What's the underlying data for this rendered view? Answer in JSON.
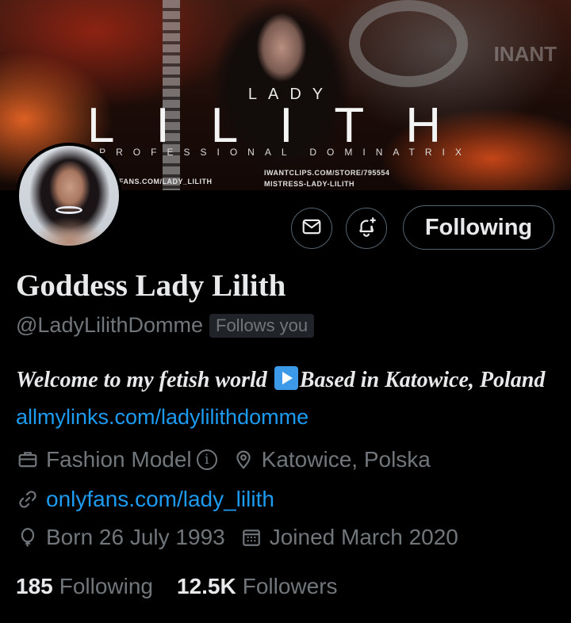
{
  "banner": {
    "lady": "LADY",
    "name": "LILITH",
    "tagline": "PROFESSIONAL DOMINATRIX",
    "link_left": "FANS.COM/LADY_LILITH",
    "link_right_1": "IWANTCLIPS.COM/STORE/795554",
    "link_right_2": "MISTRESS-LADY-LILITH",
    "watermark": "INANT"
  },
  "actions": {
    "message_icon": "envelope-icon",
    "notify_icon": "bell-plus-icon",
    "follow_label": "Following"
  },
  "profile": {
    "display_name": "Goddess Lady Lilith",
    "handle": "@LadyLilithDomme",
    "follows_you": "Follows you",
    "bio_part1": "Welcome to my fetish world ",
    "bio_part2": "Based in Katowice, Poland ",
    "bio_link": "allmylinks.com/ladylilithdomme",
    "category": "Fashion Model",
    "location": "Katowice, Polska",
    "website": "onlyfans.com/lady_lilith",
    "birthday": "Born 26 July 1993",
    "joined": "Joined March 2020",
    "following_count": "185",
    "following_label": "Following",
    "followers_count": "12.5K",
    "followers_label": "Followers"
  },
  "colors": {
    "background": "#000000",
    "text": "#e7e9ea",
    "muted": "#71767b",
    "link": "#1d9bf0",
    "border": "#536471"
  }
}
